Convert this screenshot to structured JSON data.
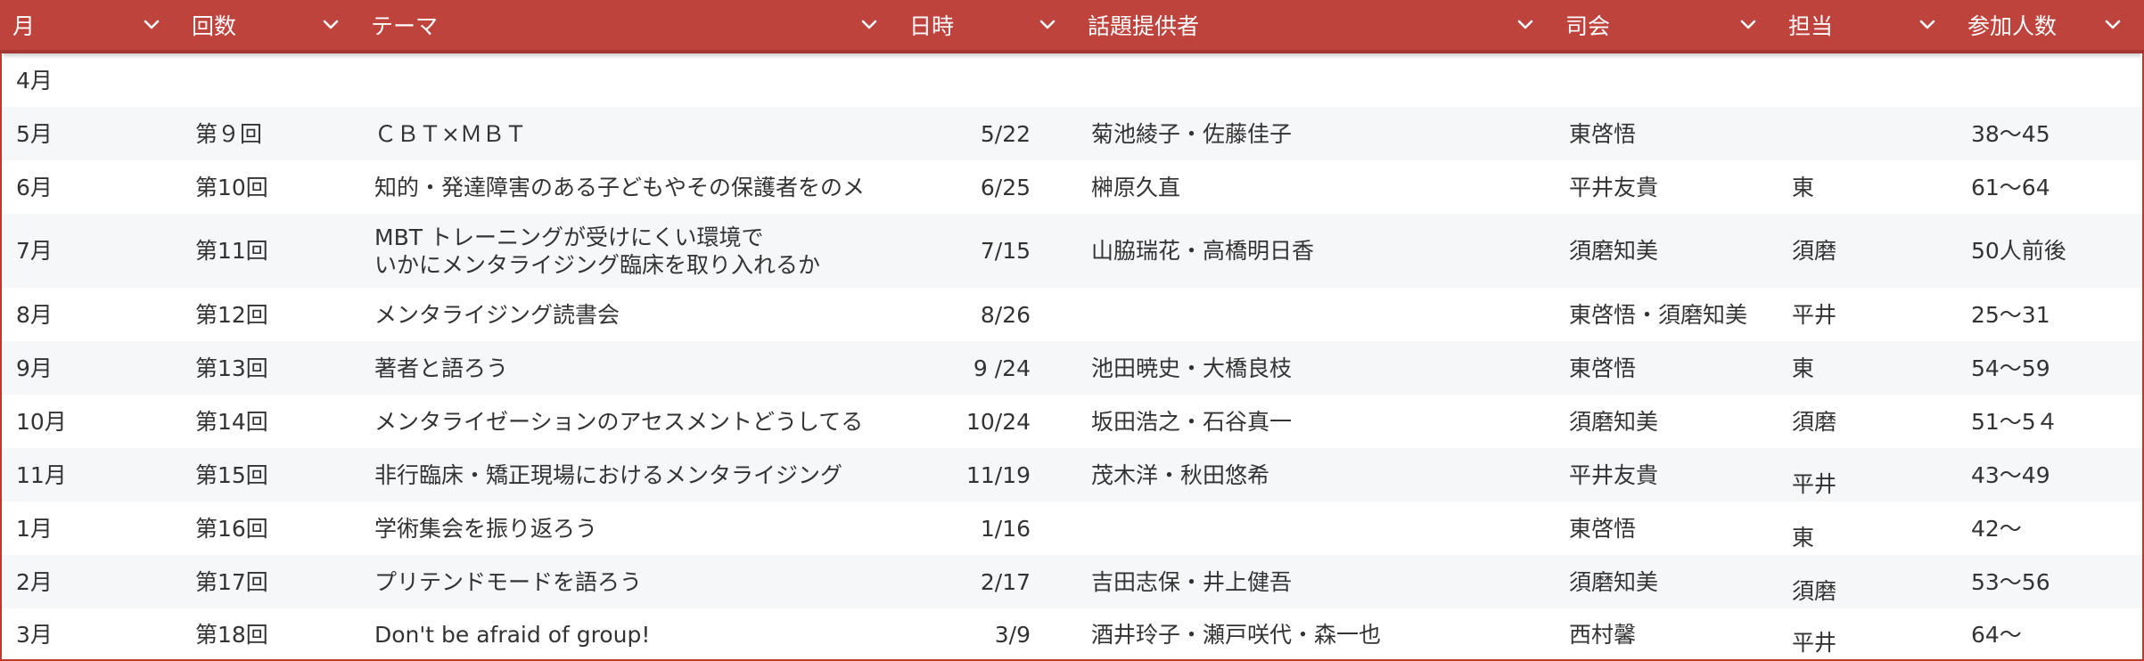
{
  "columns": [
    {
      "key": "month",
      "label": "月"
    },
    {
      "key": "round",
      "label": "回数"
    },
    {
      "key": "theme",
      "label": "テーマ"
    },
    {
      "key": "date",
      "label": "日時"
    },
    {
      "key": "provider",
      "label": "話題提供者"
    },
    {
      "key": "chair",
      "label": "司会"
    },
    {
      "key": "staff",
      "label": "担当"
    },
    {
      "key": "count",
      "label": "参加人数"
    }
  ],
  "rows": [
    {
      "month": "4月",
      "round": "",
      "theme": "",
      "date": "",
      "provider": "",
      "chair": "",
      "staff": "",
      "count": ""
    },
    {
      "month": "5月",
      "round": "第９回",
      "theme": "ＣＢＴ×ＭＢＴ",
      "date": "5/22",
      "provider": "菊池綾子・佐藤佳子",
      "chair": "東啓悟",
      "staff": "",
      "count": "38～45"
    },
    {
      "month": "6月",
      "round": "第10回",
      "theme": "知的・発達障害のある子どもやその保護者をのメ",
      "date": "6/25",
      "provider": "榊原久直",
      "chair": "平井友貴",
      "staff": "東",
      "count": "61～64"
    },
    {
      "month": "7月",
      "round": "第11回",
      "theme": "MBT トレーニングが受けにくい環境で\nいかにメンタライジング臨床を取り入れるか",
      "date": "7/15",
      "provider": "山脇瑞花・高橋明日香",
      "chair": "須磨知美",
      "staff": "須磨",
      "count": "50人前後"
    },
    {
      "month": "8月",
      "round": "第12回",
      "theme": "メンタライジング読書会",
      "date": "8/26",
      "provider": "",
      "chair": "東啓悟・須磨知美",
      "staff": "平井",
      "count": "25～31"
    },
    {
      "month": "9月",
      "round": "第13回",
      "theme": "著者と語ろう",
      "date": "9 /24",
      "provider": "池田暁史・大橋良枝",
      "chair": "東啓悟",
      "staff": "東",
      "count": "54～59"
    },
    {
      "month": "10月",
      "round": "第14回",
      "theme": "メンタライゼーションのアセスメントどうしてる",
      "date": "10/24",
      "provider": "坂田浩之・石谷真一",
      "chair": "須磨知美",
      "staff": "須磨",
      "count": "51～5４"
    },
    {
      "month": "11月",
      "round": "第15回",
      "theme": "非行臨床・矯正現場におけるメンタライジング",
      "date": "11/19",
      "provider": "茂木洋・秋田悠希",
      "chair": "平井友貴",
      "staff": "平井",
      "count": "43～49"
    },
    {
      "month": "1月",
      "round": "第16回",
      "theme": "学術集会を振り返ろう",
      "date": "1/16",
      "provider": "",
      "chair": "東啓悟",
      "staff": "東",
      "count": "42～"
    },
    {
      "month": "2月",
      "round": "第17回",
      "theme": "プリテンドモードを語ろう",
      "date": "2/17",
      "provider": "吉田志保・井上健吾",
      "chair": "須磨知美",
      "staff": "須磨",
      "count": "53～56"
    },
    {
      "month": "3月",
      "round": "第18回",
      "theme": "Don't be afraid of group!",
      "date": "3/9",
      "provider": "酒井玲子・瀬戸咲代・森一也",
      "chair": "西村馨",
      "staff": "平井",
      "count": "64～"
    }
  ]
}
